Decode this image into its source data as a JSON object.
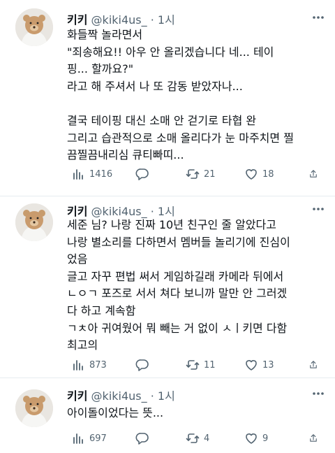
{
  "tweets": [
    {
      "name": "키키",
      "handle": "@kiki4us_",
      "separator": "·",
      "time": "1시",
      "text": "화들짝 놀라면서\n\"죄송해요!! 아우 안 올리겠습니다 네... 테이\n핑... 할까요?\"\n라고 해 주셔서 나 또 감동 받았자나...\n\n결국 테이핑 대신 소매 안 걷기로 타협 완\n그리고 습관적으로 소매 올리다가 눈 마주치면 찔\n끔찔끔내리심 큐티빠띠...",
      "views": "1416",
      "retweets": "21",
      "likes": "18"
    },
    {
      "name": "키키",
      "handle": "@kiki4us_",
      "separator": "·",
      "time": "1시",
      "text": "세준 님? 나랑 진짜 10년 친구인 줄 알았다고\n나랑 별소리를 다하면서 멤버들 놀리기에 진심이\n었음\n글고 자꾸 편법 써서 게임하길래 카메라 뒤에서\nㄴㅇㄱ 포즈로 서서 쳐다 보니까 말만 안 그러겠\n다 하고 계속함\nㄱㅊ아 귀여웠어 뭐 빼는 거 없이 ㅅㅣ키면 다함\n최고의",
      "views": "873",
      "retweets": "11",
      "likes": "13"
    },
    {
      "name": "키키",
      "handle": "@kiki4us_",
      "separator": "·",
      "time": "1시",
      "text": "아이돌이었다는 뜻...",
      "views": "697",
      "retweets": "4",
      "likes": "9"
    }
  ],
  "icons": {
    "views": "bar-chart-icon",
    "reply": "comment-icon",
    "retweet": "retweet-icon",
    "like": "heart-icon",
    "share": "share-icon",
    "more": "more-icon"
  }
}
